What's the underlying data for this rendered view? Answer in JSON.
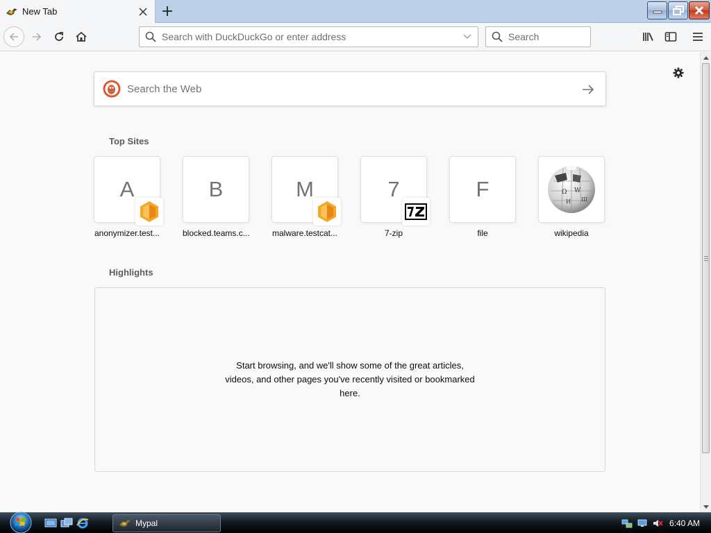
{
  "browser": {
    "tab": {
      "title": "New Tab",
      "icon": "mypal-icon",
      "close_icon": "close-icon"
    },
    "new_tab_icon": "plus-icon",
    "window_controls": [
      "minimize-icon",
      "restore-icon",
      "close-icon"
    ],
    "urlbar": {
      "placeholder": "Search with DuckDuckGo or enter address",
      "value": ""
    },
    "searchbar": {
      "placeholder": "Search",
      "value": ""
    }
  },
  "newtab": {
    "web_search": {
      "placeholder": "Search the Web",
      "engine_icon": "duckduckgo-icon"
    },
    "top_sites_title": "Top Sites",
    "top_sites": [
      {
        "letter": "A",
        "label": "anonymizer.test...",
        "badge": "hexagon-badge-icon"
      },
      {
        "letter": "B",
        "label": "blocked.teams.c...",
        "badge": ""
      },
      {
        "letter": "M",
        "label": "malware.testcat...",
        "badge": "hexagon-badge-icon"
      },
      {
        "letter": "7",
        "label": "7-zip",
        "badge": "7zip-badge-icon"
      },
      {
        "letter": "F",
        "label": "file",
        "badge": ""
      },
      {
        "letter": "",
        "label": "wikipedia",
        "badge": "wikipedia-globe-icon"
      }
    ],
    "highlights_title": "Highlights",
    "highlights_message": "Start browsing, and we'll show some of the great articles, videos, and other pages you've recently visited or bookmarked here."
  },
  "taskbar": {
    "task_label": "Mypal",
    "clock": "6:40 AM"
  },
  "colors": {
    "accent": "#bcd0ea",
    "badge_orange": "#f5a623"
  }
}
